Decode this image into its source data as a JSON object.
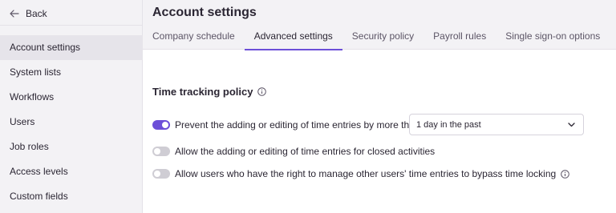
{
  "sidebar": {
    "back_label": "Back",
    "items": [
      {
        "label": "Account settings",
        "active": true
      },
      {
        "label": "System lists"
      },
      {
        "label": "Workflows"
      },
      {
        "label": "Users"
      },
      {
        "label": "Job roles"
      },
      {
        "label": "Access levels"
      },
      {
        "label": "Custom fields"
      }
    ]
  },
  "header": {
    "title": "Account settings",
    "tabs": [
      {
        "label": "Company schedule"
      },
      {
        "label": "Advanced settings",
        "active": true
      },
      {
        "label": "Security policy"
      },
      {
        "label": "Payroll rules"
      },
      {
        "label": "Single sign-on options"
      }
    ]
  },
  "section": {
    "title": "Time tracking policy",
    "settings": [
      {
        "label": "Prevent the adding or editing of time entries by more than",
        "enabled": true
      },
      {
        "label": "Allow the adding or editing of time entries for closed activities",
        "enabled": false
      },
      {
        "label": "Allow users who have the right to manage other users' time entries to bypass time locking",
        "enabled": false
      }
    ],
    "period_select": {
      "value": "1 day in the past"
    }
  },
  "colors": {
    "accent": "#6c4fd8",
    "toggle_off": "#cfcdd4",
    "sidebar_bg": "#f3f2f5",
    "active_nav_bg": "#e6e4ea"
  }
}
